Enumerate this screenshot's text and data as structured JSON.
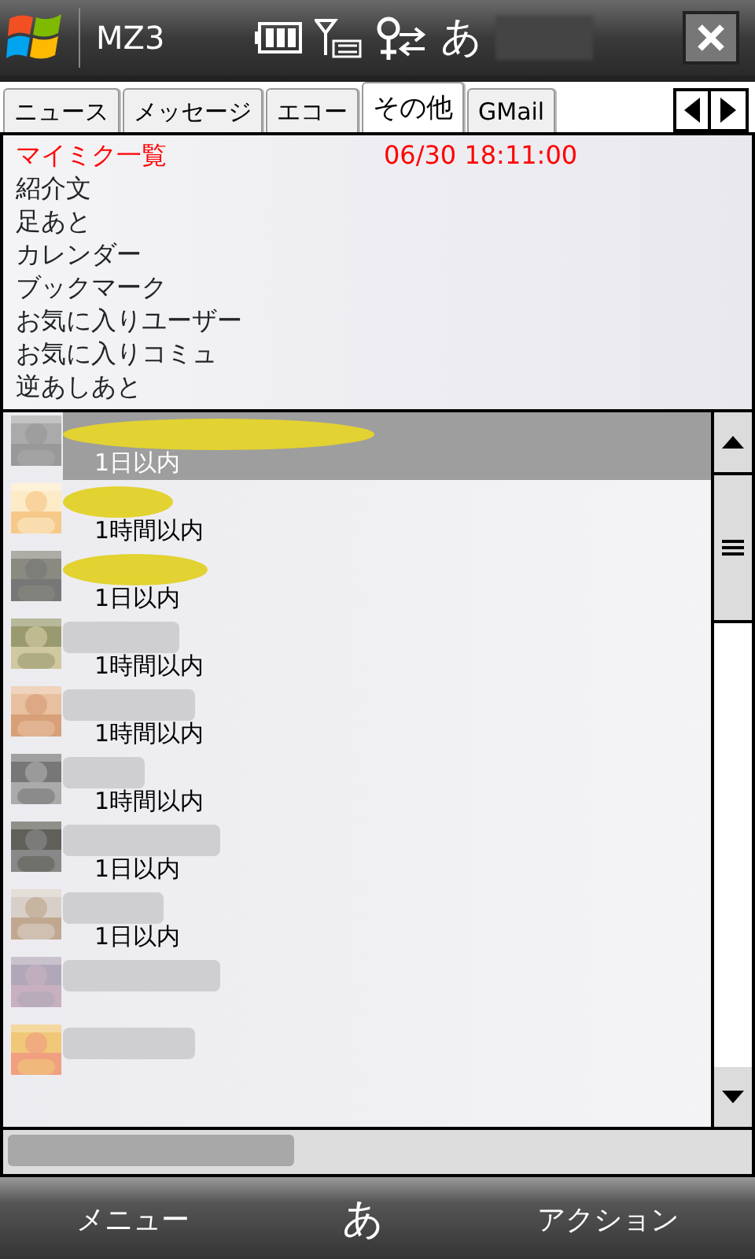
{
  "title_bar": {
    "title": "MZ3",
    "input_mode": "あ"
  },
  "tabs": [
    {
      "label": "ニュース",
      "selected": false
    },
    {
      "label": "メッセージ",
      "selected": false
    },
    {
      "label": "エコー",
      "selected": false
    },
    {
      "label": "その他",
      "selected": true
    },
    {
      "label": "GMail",
      "selected": false
    }
  ],
  "category_list": {
    "header": {
      "label": "マイミク一覧",
      "time": "06/30 18:11:00"
    },
    "items": [
      "紹介文",
      "足あと",
      "カレンダー",
      "ブックマーク",
      "お気に入りユーザー",
      "お気に入りコミュ",
      "逆あしあと"
    ]
  },
  "friend_list": [
    {
      "kind": "highlight",
      "time": "1日以内",
      "selected": true
    },
    {
      "kind": "highlight",
      "time": "1時間以内",
      "selected": false
    },
    {
      "kind": "highlight",
      "time": "1日以内",
      "selected": false
    },
    {
      "kind": "blur",
      "time": "1時間以内",
      "selected": false
    },
    {
      "kind": "blur",
      "time": "1時間以内",
      "selected": false
    },
    {
      "kind": "blur",
      "time": "1時間以内",
      "selected": false
    },
    {
      "kind": "blur",
      "time": "1日以内",
      "selected": false
    },
    {
      "kind": "blur",
      "time": "1日以内",
      "selected": false
    },
    {
      "kind": "blur",
      "selected": false
    },
    {
      "kind": "blur",
      "selected": false
    }
  ],
  "soft_keys": {
    "left": "メニュー",
    "center": "あ",
    "right": "アクション"
  }
}
